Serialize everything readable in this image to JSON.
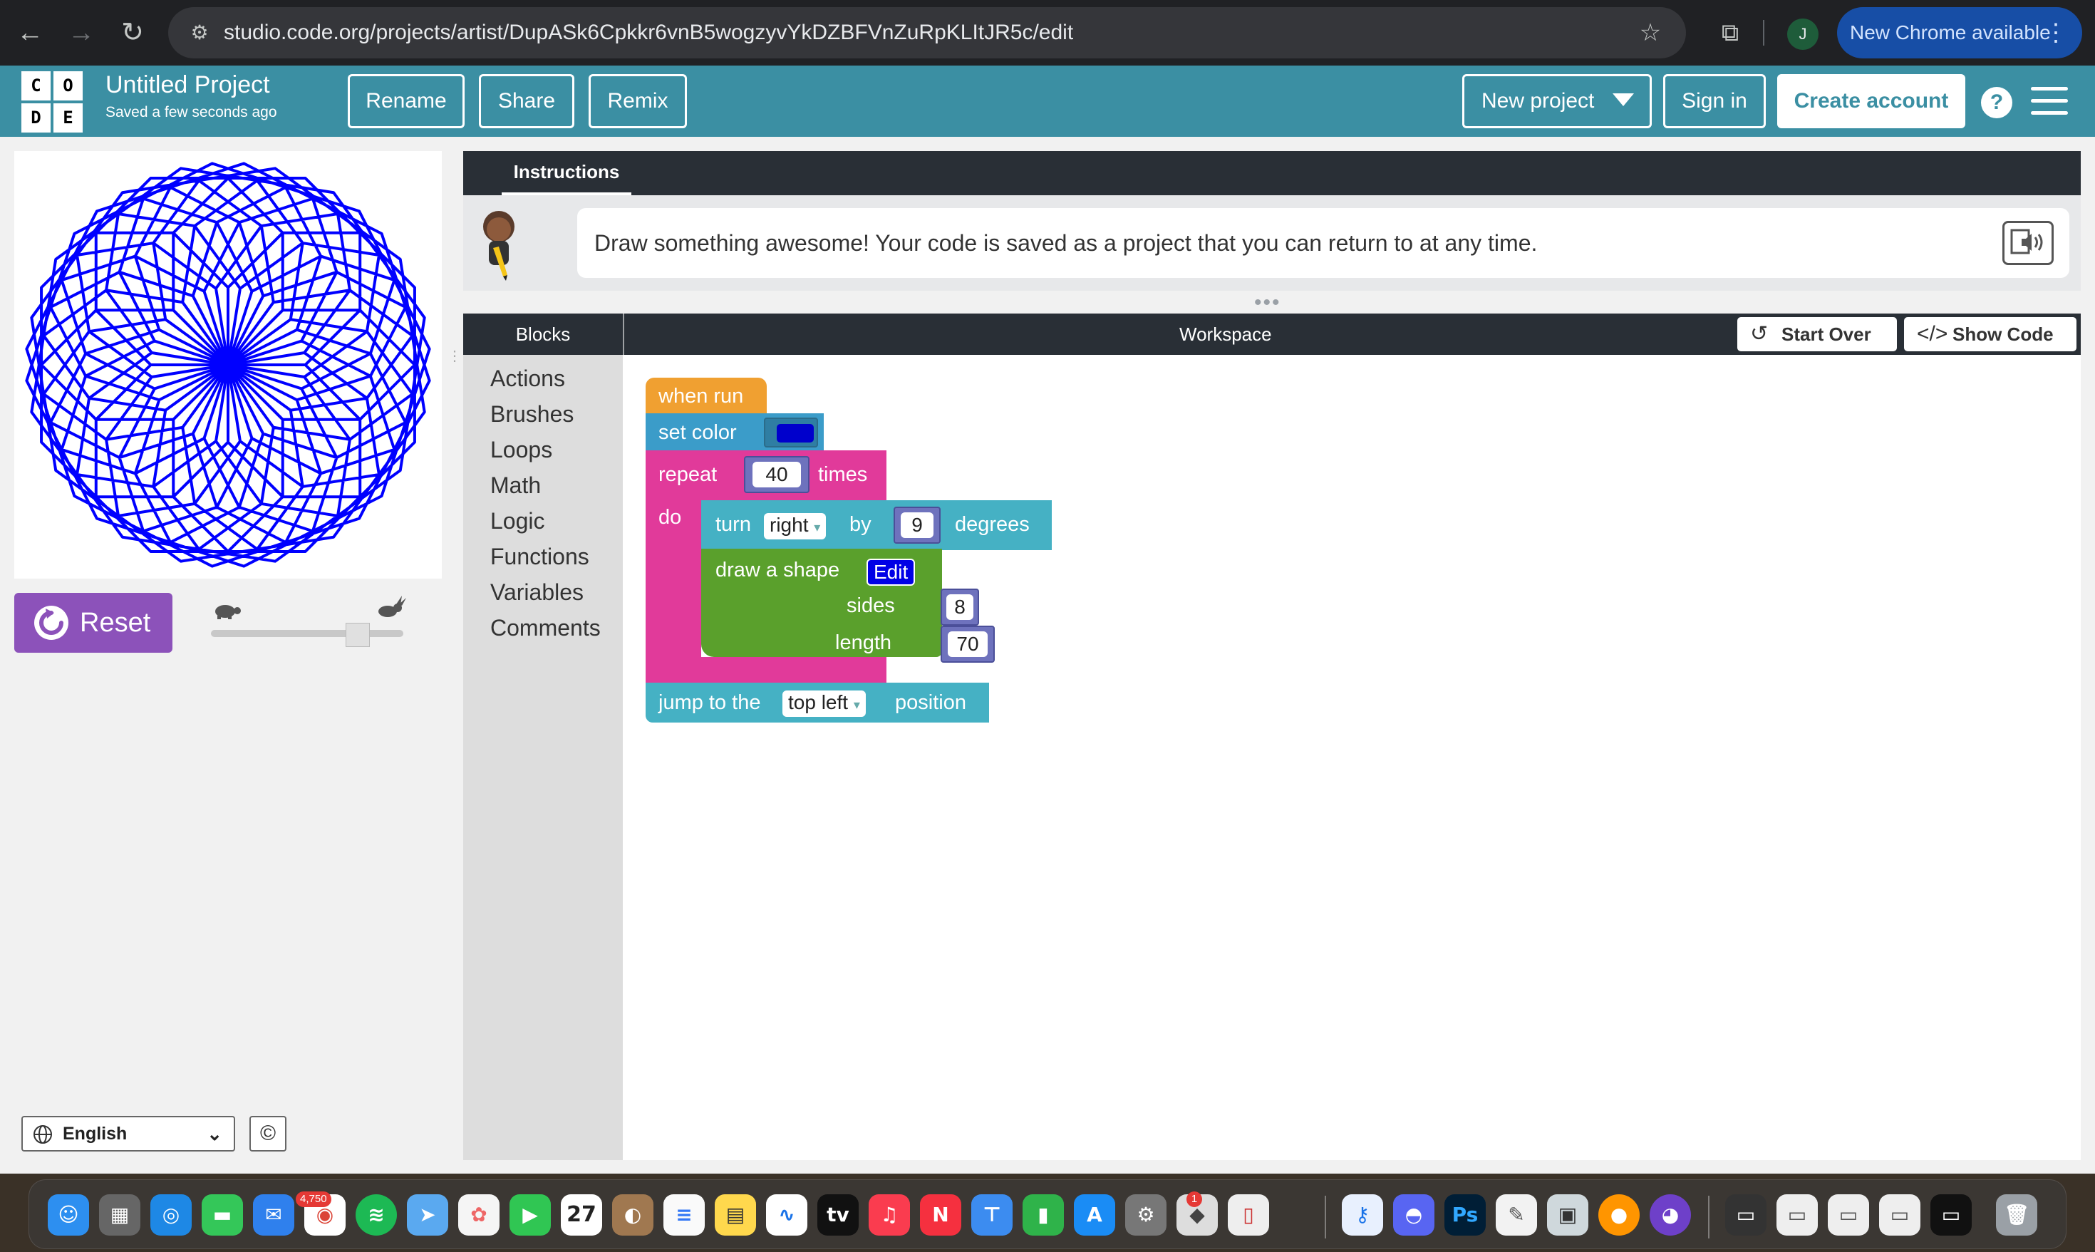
{
  "browser": {
    "url": "studio.code.org/projects/artist/DupASk6Cpkkr6vnB5wogzyvYkDZBFVnZuRpKLItJR5c/edit",
    "profile_initial": "J",
    "update_label": "New Chrome available"
  },
  "header": {
    "logo_letters": [
      "C",
      "O",
      "D",
      "E"
    ],
    "project_title": "Untitled Project",
    "saved_status": "Saved a few seconds ago",
    "rename_label": "Rename",
    "share_label": "Share",
    "remix_label": "Remix",
    "new_project_label": "New project",
    "sign_in_label": "Sign in",
    "create_account_label": "Create account",
    "help_glyph": "?",
    "brand_color": "#3b8fa3"
  },
  "artist": {
    "draw_color": "#0000ff",
    "reset_label": "Reset",
    "speed_level": 0.8
  },
  "footer": {
    "language": "English",
    "copyright_glyph": "©"
  },
  "instructions": {
    "tab_label": "Instructions",
    "text": "Draw something awesome! Your code is saved as a project that you can return to at any time."
  },
  "workspace": {
    "blocks_title": "Blocks",
    "title": "Workspace",
    "start_over_label": "Start Over",
    "show_code_label": "Show Code",
    "categories": [
      "Actions",
      "Brushes",
      "Loops",
      "Math",
      "Logic",
      "Functions",
      "Variables",
      "Comments"
    ]
  },
  "program": {
    "when_run": "when run",
    "set_color": "set color",
    "color_value": "#0000cc",
    "repeat": "repeat",
    "repeat_count": "40",
    "times": "times",
    "do": "do",
    "turn": "turn",
    "turn_direction": "right",
    "by": "by",
    "turn_amount": "9",
    "degrees": "degrees",
    "draw_shape": "draw a shape",
    "edit_label": "Edit",
    "sides_label": "sides",
    "sides_value": "8",
    "length_label": "length",
    "length_value": "70",
    "jump_to_the": "jump to the",
    "jump_target": "top left",
    "position": "position"
  },
  "dock": {
    "mail_badge": "4,750",
    "calendar_day": "27",
    "settings_badge": "1"
  }
}
